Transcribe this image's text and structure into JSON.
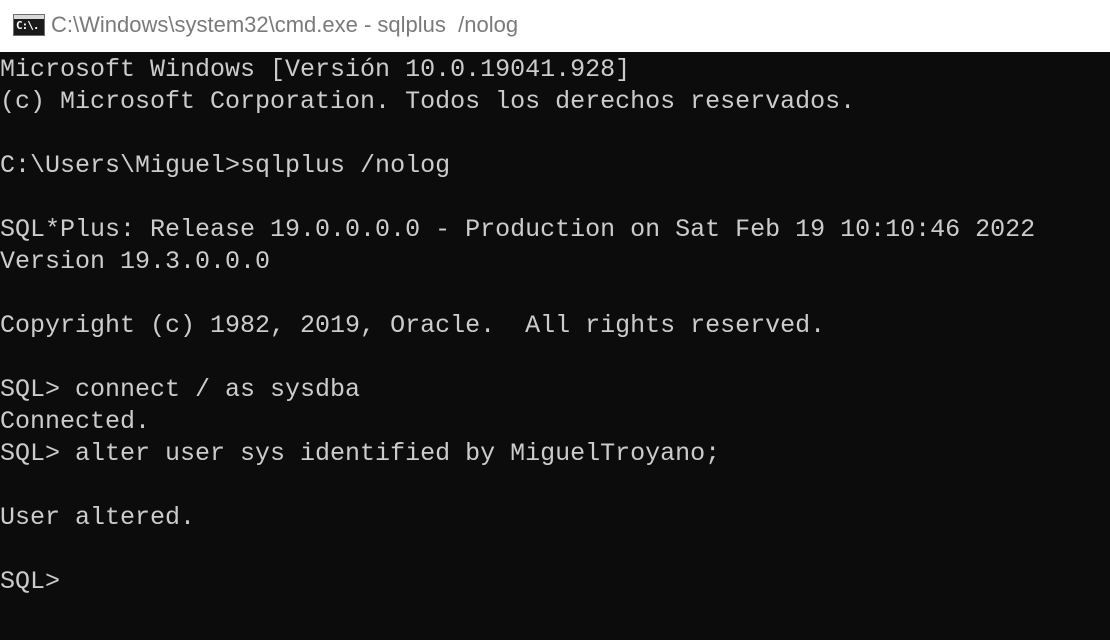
{
  "window": {
    "title": "C:\\Windows\\system32\\cmd.exe - sqlplus  /nolog",
    "icon": "cmd-icon",
    "icon_glyph": "C:\\."
  },
  "terminal": {
    "colors": {
      "background": "#0c0c0c",
      "foreground": "#cccccc"
    },
    "lines": [
      "Microsoft Windows [Versión 10.0.19041.928]",
      "(c) Microsoft Corporation. Todos los derechos reservados.",
      "",
      "C:\\Users\\Miguel>sqlplus /nolog",
      "",
      "SQL*Plus: Release 19.0.0.0.0 - Production on Sat Feb 19 10:10:46 2022",
      "Version 19.3.0.0.0",
      "",
      "Copyright (c) 1982, 2019, Oracle.  All rights reserved.",
      "",
      "SQL> connect / as sysdba",
      "Connected.",
      "SQL> alter user sys identified by MiguelTroyano;",
      "",
      "User altered.",
      "",
      "SQL>"
    ]
  }
}
